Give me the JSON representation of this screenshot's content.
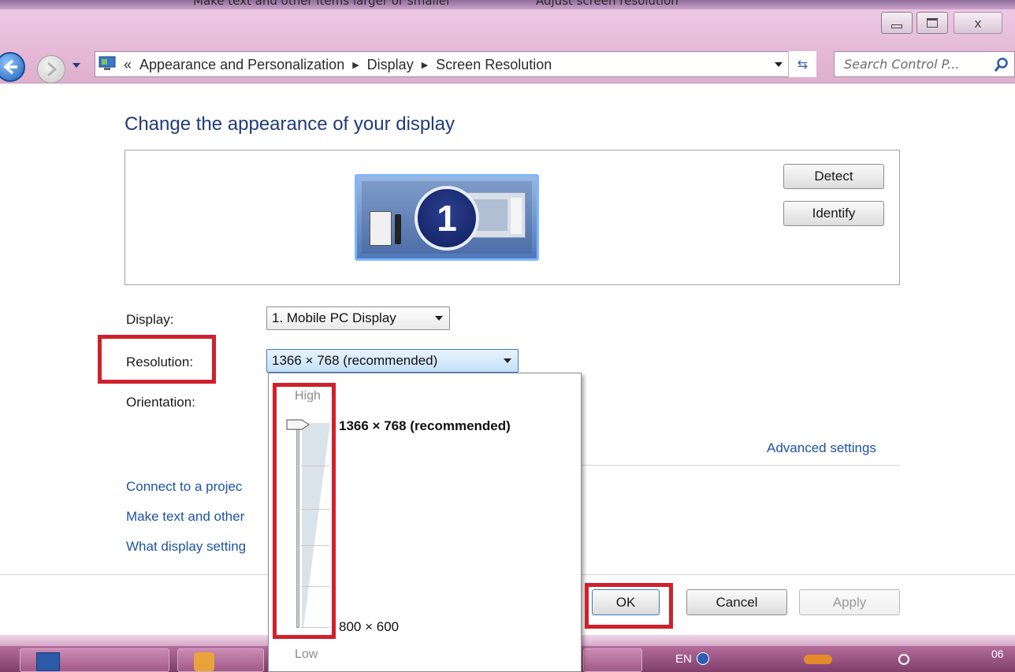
{
  "window": {
    "behind_titles": [
      "Make text and other items larger or smaller",
      "Adjust screen resolution"
    ],
    "minimize_icon": "minimize-icon",
    "maximize_icon": "maximize-icon",
    "close_icon": "close-icon",
    "close_glyph": "ⅹ"
  },
  "nav": {
    "chevrons": "«",
    "breadcrumbs": [
      "Appearance and Personalization",
      "Display",
      "Screen Resolution"
    ],
    "search_placeholder": "Search Control P..."
  },
  "page": {
    "heading": "Change the appearance of your display",
    "monitor_number": "1",
    "detect_label": "Detect",
    "identify_label": "Identify",
    "display_label": "Display:",
    "display_value": "1. Mobile PC Display",
    "resolution_label": "Resolution:",
    "resolution_value": "1366 × 768 (recommended)",
    "orientation_label": "Orientation:",
    "advanced_link": "Advanced settings",
    "links": [
      "Connect to a projec",
      "Make text and other",
      "What display setting"
    ]
  },
  "dropdown": {
    "high_label": "High",
    "low_label": "Low",
    "max_option": "1366 × 768 (recommended)",
    "min_option": "800 × 600",
    "slider_level": 1.0
  },
  "footer": {
    "ok_label": "OK",
    "cancel_label": "Cancel",
    "apply_label": "Apply"
  },
  "taskbar": {
    "language": "EN",
    "clock_partial": "06"
  },
  "colors": {
    "highlight_box": "#d0202b",
    "link": "#1e52a5",
    "heading": "#1f3b79",
    "chrome": "#e6bcd8"
  }
}
